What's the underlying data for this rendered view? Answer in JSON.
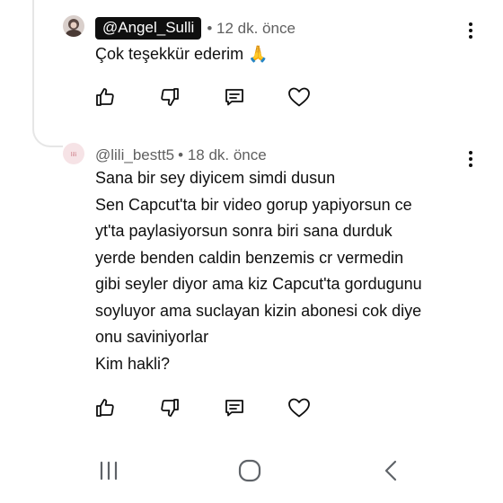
{
  "comments": [
    {
      "handle": "@Angel_Sulli",
      "handle_style": "pill",
      "time": "• 12 dk. önce",
      "lines": [
        "Çok teşekkür ederim 🙏"
      ]
    },
    {
      "handle": "@lili_bestt5",
      "handle_style": "plain",
      "avatar_text": "lili",
      "time": "• 18 dk. önce",
      "lines": [
        "Sana bir sey diyicem simdi dusun",
        "Sen Capcut'ta bir video gorup yapiyorsun ce",
        "yt'ta paylasiyorsun sonra biri sana durduk",
        "yerde benden caldin benzemis cr vermedin",
        "gibi seyler diyor ama kiz Capcut'ta gordugunu",
        "soyluyor ama suclayan kizin abonesi cok diye",
        "onu saviniyorlar",
        "Kim hakli?"
      ]
    }
  ],
  "icons": {
    "like": "thumbs-up-icon",
    "dislike": "thumbs-down-icon",
    "reply": "reply-icon",
    "heart": "heart-icon",
    "more": "more-vertical-icon",
    "nav_recents": "recent-apps-icon",
    "nav_home": "home-icon",
    "nav_back": "back-icon"
  },
  "colors": {
    "text": "#0f0f0f",
    "meta": "#606060",
    "pill_bg": "#0f0f0f",
    "thread": "#e6e6e6",
    "nav_icon": "#5f6368"
  }
}
